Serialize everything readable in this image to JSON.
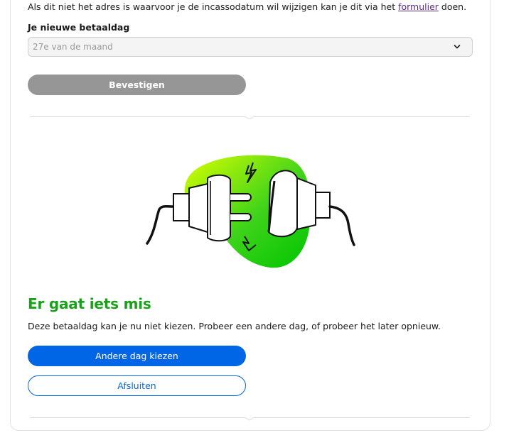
{
  "intro": {
    "text_before": "Als dit niet het adres is waarvoor je de incassodatum wil wijzigen kan je dit via het ",
    "link_label": "formulier",
    "text_after": " doen."
  },
  "payday": {
    "label": "Je nieuwe betaaldag",
    "selected_value": "27e van de maand"
  },
  "confirm_button": "Bevestigen",
  "error": {
    "title": "Er gaat iets mis",
    "message": "Deze betaaldag kan je nu niet kiezen. Probeer een andere dag, of probeer het later opnieuw.",
    "illustration": "unplugged-cable-illustration"
  },
  "actions": {
    "choose_other_day": "Andere dag kiezen",
    "close": "Afsluiten"
  },
  "colors": {
    "accent_green": "#1ba01b",
    "primary_blue": "#0066e6",
    "disabled_gray": "#969696",
    "link_purple": "#5a2d82"
  }
}
